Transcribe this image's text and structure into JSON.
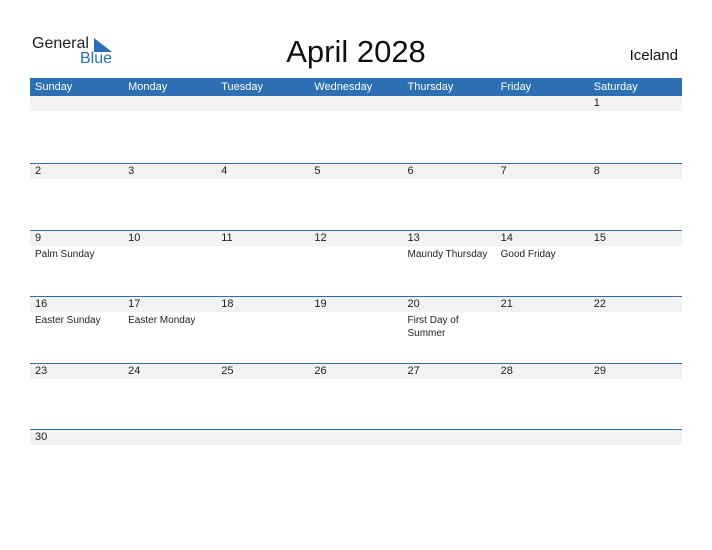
{
  "logo": {
    "general": "General",
    "blue": "Blue"
  },
  "title": "April 2028",
  "country": "Iceland",
  "weekdays": [
    "Sunday",
    "Monday",
    "Tuesday",
    "Wednesday",
    "Thursday",
    "Friday",
    "Saturday"
  ],
  "weeks": [
    {
      "days": [
        "",
        "",
        "",
        "",
        "",
        "",
        "1"
      ],
      "events": [
        "",
        "",
        "",
        "",
        "",
        "",
        ""
      ]
    },
    {
      "days": [
        "2",
        "3",
        "4",
        "5",
        "6",
        "7",
        "8"
      ],
      "events": [
        "",
        "",
        "",
        "",
        "",
        "",
        ""
      ]
    },
    {
      "days": [
        "9",
        "10",
        "11",
        "12",
        "13",
        "14",
        "15"
      ],
      "events": [
        "Palm Sunday",
        "",
        "",
        "",
        "Maundy Thursday",
        "Good Friday",
        ""
      ]
    },
    {
      "days": [
        "16",
        "17",
        "18",
        "19",
        "20",
        "21",
        "22"
      ],
      "events": [
        "Easter Sunday",
        "Easter Monday",
        "",
        "",
        "First Day of Summer",
        "",
        ""
      ]
    },
    {
      "days": [
        "23",
        "24",
        "25",
        "26",
        "27",
        "28",
        "29"
      ],
      "events": [
        "",
        "",
        "",
        "",
        "",
        "",
        ""
      ]
    },
    {
      "days": [
        "30",
        "",
        "",
        "",
        "",
        "",
        ""
      ],
      "events": [
        "",
        "",
        "",
        "",
        "",
        "",
        ""
      ]
    }
  ],
  "colors": {
    "header": "#2d6fb3",
    "logo_blue": "#2a6fbb",
    "day_strip": "#f2f2f2"
  }
}
